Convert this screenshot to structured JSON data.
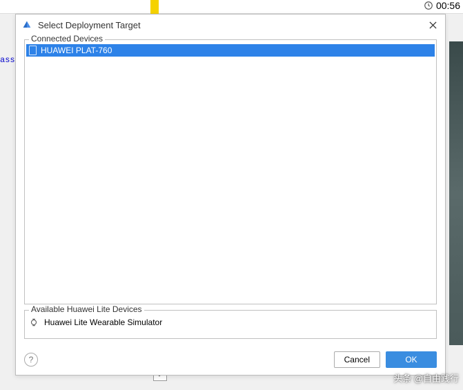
{
  "topbar": {
    "time": "00:56"
  },
  "bg": {
    "left_text": "ass."
  },
  "dialog": {
    "title": "Select Deployment Target"
  },
  "connected": {
    "label": "Connected Devices",
    "items": [
      {
        "name": "HUAWEI PLAT-760",
        "selected": true
      }
    ]
  },
  "available": {
    "label": "Available Huawei Lite Devices",
    "items": [
      {
        "name": "Huawei Lite Wearable Simulator"
      }
    ]
  },
  "buttons": {
    "cancel": "Cancel",
    "ok": "OK",
    "help": "?"
  },
  "watermark": "头条 @自由践行"
}
